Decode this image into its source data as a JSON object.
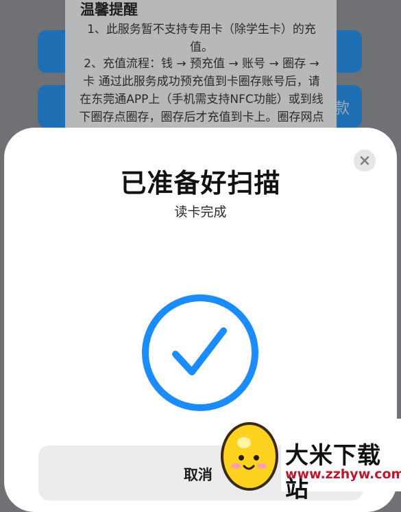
{
  "background": {
    "notice_title": "温馨提醒",
    "notice_p1": "1、此服务暂不支持专用卡（除学生卡）的充值。",
    "notice_p2": "2、充值流程：钱 → 预充值 → 账号 → 圈存 → 卡  通过此服务成功预充值到卡圈存账号后，请在东莞通APP上（手机需支持NFC功能）或到线下圈存点圈存，圈存后才充值到卡上。圈存网点见“东莞通”微信",
    "side_text": "款"
  },
  "sheet": {
    "title": "已准备好扫描",
    "subtitle": "读卡完成",
    "cancel_label": "取消",
    "accent_color": "#1a8cff"
  },
  "watermark": {
    "name": "大米下载站",
    "url": "www.zzhyw.com"
  }
}
